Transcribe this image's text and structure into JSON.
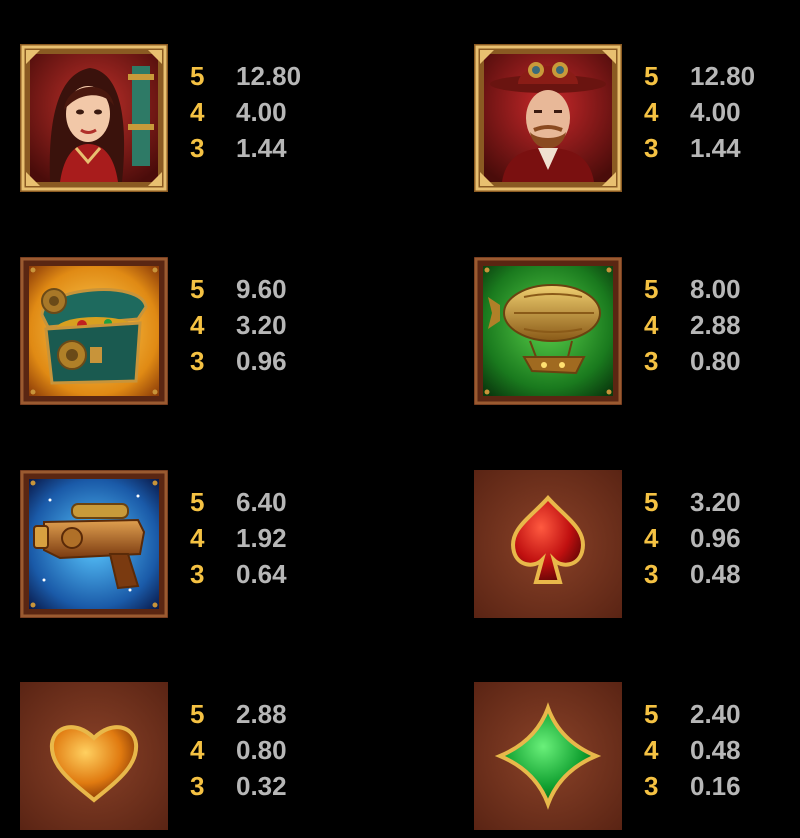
{
  "paytable": [
    {
      "symbol": "woman-portrait",
      "pays": [
        {
          "count": "5",
          "value": "12.80"
        },
        {
          "count": "4",
          "value": "4.00"
        },
        {
          "count": "3",
          "value": "1.44"
        }
      ]
    },
    {
      "symbol": "man-portrait",
      "pays": [
        {
          "count": "5",
          "value": "12.80"
        },
        {
          "count": "4",
          "value": "4.00"
        },
        {
          "count": "3",
          "value": "1.44"
        }
      ]
    },
    {
      "symbol": "treasure-chest",
      "pays": [
        {
          "count": "5",
          "value": "9.60"
        },
        {
          "count": "4",
          "value": "3.20"
        },
        {
          "count": "3",
          "value": "0.96"
        }
      ]
    },
    {
      "symbol": "airship",
      "pays": [
        {
          "count": "5",
          "value": "8.00"
        },
        {
          "count": "4",
          "value": "2.88"
        },
        {
          "count": "3",
          "value": "0.80"
        }
      ]
    },
    {
      "symbol": "ray-gun",
      "pays": [
        {
          "count": "5",
          "value": "6.40"
        },
        {
          "count": "4",
          "value": "1.92"
        },
        {
          "count": "3",
          "value": "0.64"
        }
      ]
    },
    {
      "symbol": "spade",
      "pays": [
        {
          "count": "5",
          "value": "3.20"
        },
        {
          "count": "4",
          "value": "0.96"
        },
        {
          "count": "3",
          "value": "0.48"
        }
      ]
    },
    {
      "symbol": "heart",
      "pays": [
        {
          "count": "5",
          "value": "2.88"
        },
        {
          "count": "4",
          "value": "0.80"
        },
        {
          "count": "3",
          "value": "0.32"
        }
      ]
    },
    {
      "symbol": "diamond",
      "pays": [
        {
          "count": "5",
          "value": "2.40"
        },
        {
          "count": "4",
          "value": "0.48"
        },
        {
          "count": "3",
          "value": "0.16"
        }
      ]
    }
  ],
  "colors": {
    "count": "#f5c243",
    "value": "#b7b7b7",
    "frame_gold": "#c8943a",
    "tile_brown": "#7a3a22"
  }
}
